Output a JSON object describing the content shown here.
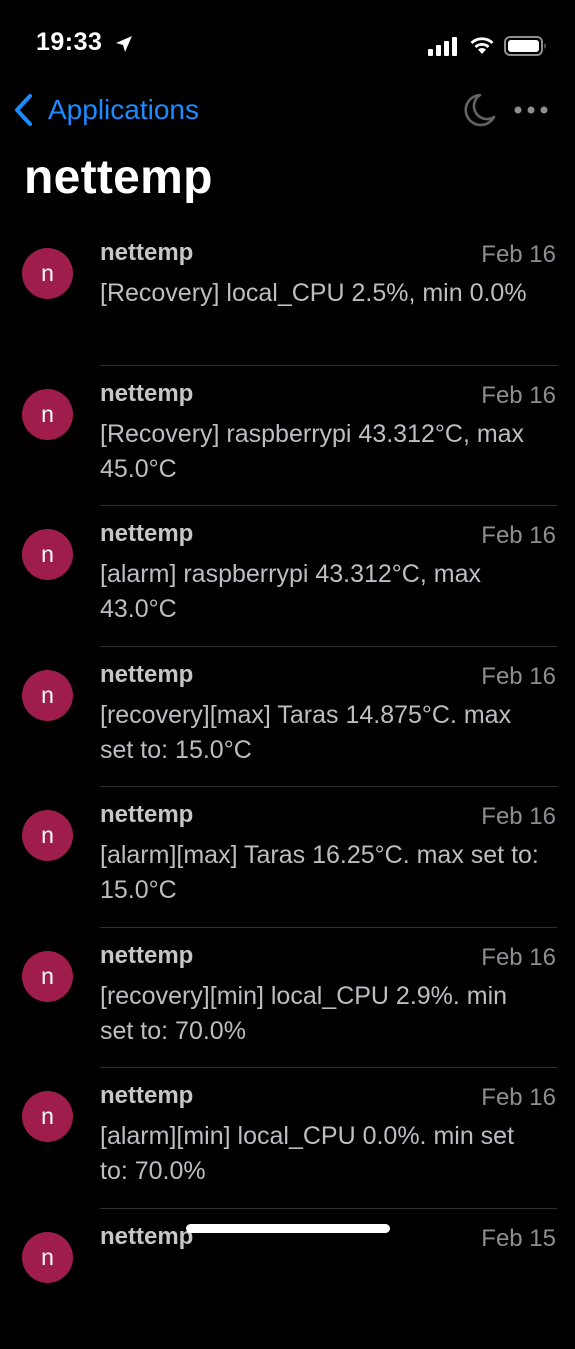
{
  "status_bar": {
    "time": "19:33"
  },
  "nav": {
    "back_label": "Applications"
  },
  "page": {
    "title": "nettemp"
  },
  "colors": {
    "accent": "#1a8cff",
    "avatar_bg": "#9e1d4c",
    "background": "#000000"
  },
  "messages": [
    {
      "avatar_letter": "n",
      "title": "nettemp",
      "date": "Feb 16",
      "body": "[Recovery] local_CPU 2.5%, min 0.0%"
    },
    {
      "avatar_letter": "n",
      "title": "nettemp",
      "date": "Feb 16",
      "body": "[Recovery] raspberrypi 43.312°C, max 45.0°C"
    },
    {
      "avatar_letter": "n",
      "title": "nettemp",
      "date": "Feb 16",
      "body": "[alarm] raspberrypi 43.312°C, max 43.0°C"
    },
    {
      "avatar_letter": "n",
      "title": "nettemp",
      "date": "Feb 16",
      "body": "[recovery][max] Taras 14.875°C. max set to: 15.0°C"
    },
    {
      "avatar_letter": "n",
      "title": "nettemp",
      "date": "Feb 16",
      "body": "[alarm][max] Taras 16.25°C. max set to: 15.0°C"
    },
    {
      "avatar_letter": "n",
      "title": "nettemp",
      "date": "Feb 16",
      "body": "[recovery][min] local_CPU 2.9%. min set to: 70.0%"
    },
    {
      "avatar_letter": "n",
      "title": "nettemp",
      "date": "Feb 16",
      "body": "[alarm][min] local_CPU 0.0%. min set to: 70.0%"
    },
    {
      "avatar_letter": "n",
      "title": "nettemp",
      "date": "Feb 15",
      "body": ""
    }
  ]
}
